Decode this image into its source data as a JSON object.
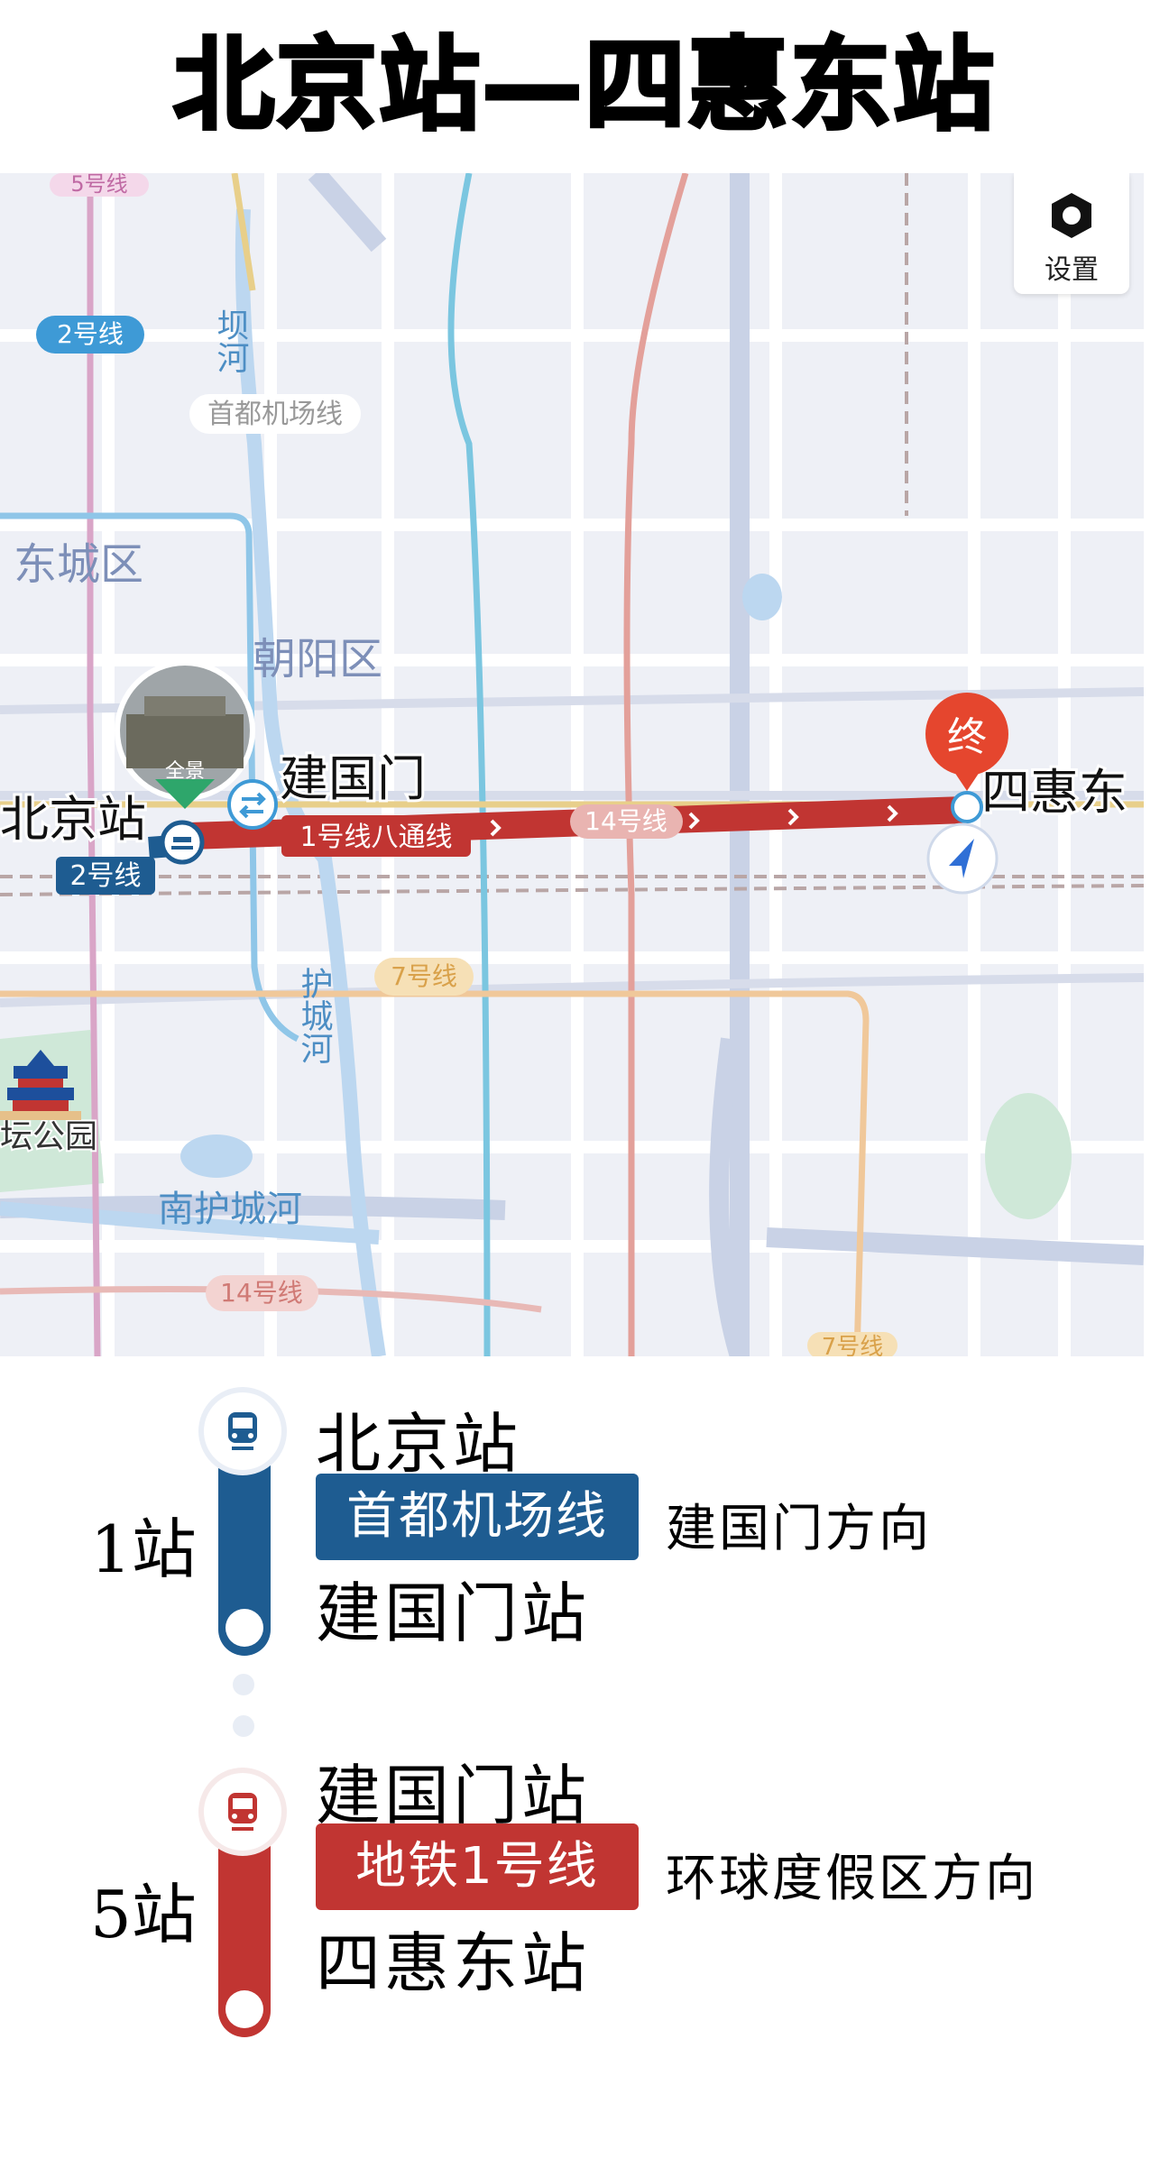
{
  "title": "北京站—四惠东站",
  "map": {
    "settings_label": "设置",
    "labels": {
      "line5": "5号线",
      "line2_top": "2号线",
      "river_ba": "坝河",
      "airport_line": "首都机场线",
      "dongcheng": "东城区",
      "chaoyang": "朝阳区",
      "panorama": "全景",
      "jianguomen": "建国门",
      "beijingzhan": "北京站",
      "line2_station": "2号线",
      "line1_batong": "1号线八通线",
      "line14": "14号线",
      "end_marker": "终",
      "sihuidong": "四惠东",
      "line7": "7号线",
      "hucheng_river": "护城河",
      "park": "坛公园",
      "nanhucheng_river": "南护城河",
      "line14_bottom": "14号线",
      "line7_bottom": "7号线"
    }
  },
  "segments": [
    {
      "stops": "1站",
      "from": "北京站",
      "line": "首都机场线",
      "direction": "建国门方向",
      "to": "建国门站",
      "color": "#1e5c91"
    },
    {
      "stops": "5站",
      "from": "建国门站",
      "line": "地铁1号线",
      "direction": "环球度假区方向",
      "to": "四惠东站",
      "color": "#c13532"
    }
  ]
}
